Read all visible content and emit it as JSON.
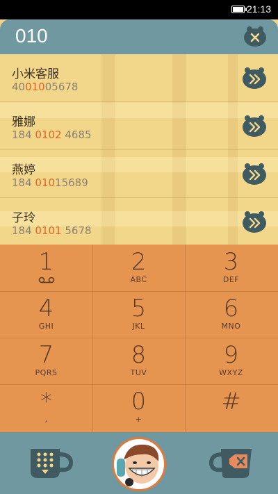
{
  "status": {
    "time": "21:13"
  },
  "search": {
    "query": "010"
  },
  "contacts": [
    {
      "name": "小米客服",
      "pre": "40",
      "match": "010",
      "post": "05678"
    },
    {
      "name": "雅娜",
      "pre": "184 ",
      "match": "0102",
      "post": " 4685"
    },
    {
      "name": "燕婷",
      "pre": "184 ",
      "match": "010",
      "post": "15689"
    },
    {
      "name": "子玲",
      "pre": "184 ",
      "match": "0101",
      "post": " 5678"
    }
  ],
  "keypad": [
    {
      "digit": "1",
      "letters": "voicemail-icon"
    },
    {
      "digit": "2",
      "letters": "ABC"
    },
    {
      "digit": "3",
      "letters": "DEF"
    },
    {
      "digit": "4",
      "letters": "GHI"
    },
    {
      "digit": "5",
      "letters": "JKL"
    },
    {
      "digit": "6",
      "letters": "MNO"
    },
    {
      "digit": "7",
      "letters": "PQRS"
    },
    {
      "digit": "8",
      "letters": "TUV"
    },
    {
      "digit": "9",
      "letters": "WXYZ"
    },
    {
      "digit": "*",
      "letters": ","
    },
    {
      "digit": "0",
      "letters": "+"
    },
    {
      "digit": "#",
      "letters": ""
    }
  ],
  "colors": {
    "accent": "#6f98a0",
    "keypad": "#e59550",
    "list": "#f2d78a",
    "highlight": "#e2622a"
  }
}
